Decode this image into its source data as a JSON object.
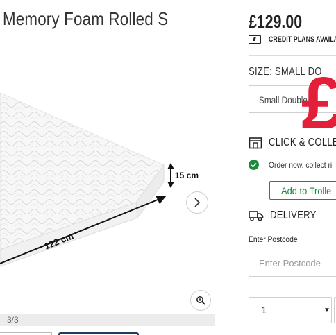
{
  "product": {
    "title": "Memory Foam Rolled S",
    "image_alt": "White quilted memory foam mattress",
    "dimension_depth": "15 cm",
    "dimension_length": "122 cm",
    "image_counter": "3/3"
  },
  "purchase": {
    "price": "£129.00",
    "credit_label": "CREDIT PLANS AVAILA",
    "size_label": "SIZE: SMALL DO",
    "size_selected": "Small Double -",
    "overlay_glyph": "£",
    "click_collect_title": "CLICK & COLLEC",
    "order_text": "Order now, collect ri",
    "add_trolley_label": "Add to Trolle",
    "delivery_title": "DELIVERY",
    "postcode_label": "Enter Postcode",
    "postcode_placeholder": "Enter Postcode",
    "quantity": "1",
    "quantity_arrow": "▼"
  },
  "icons": {
    "credit": "credit-card-icon",
    "store": "store-icon",
    "check": "check-circle-icon",
    "truck": "truck-icon",
    "next": "chevron-right-icon",
    "zoom": "zoom-in-icon"
  },
  "colors": {
    "accent_green": "#1e8a3e",
    "overlay_red": "#e2203a",
    "thumb_active": "#1f3c5e"
  }
}
